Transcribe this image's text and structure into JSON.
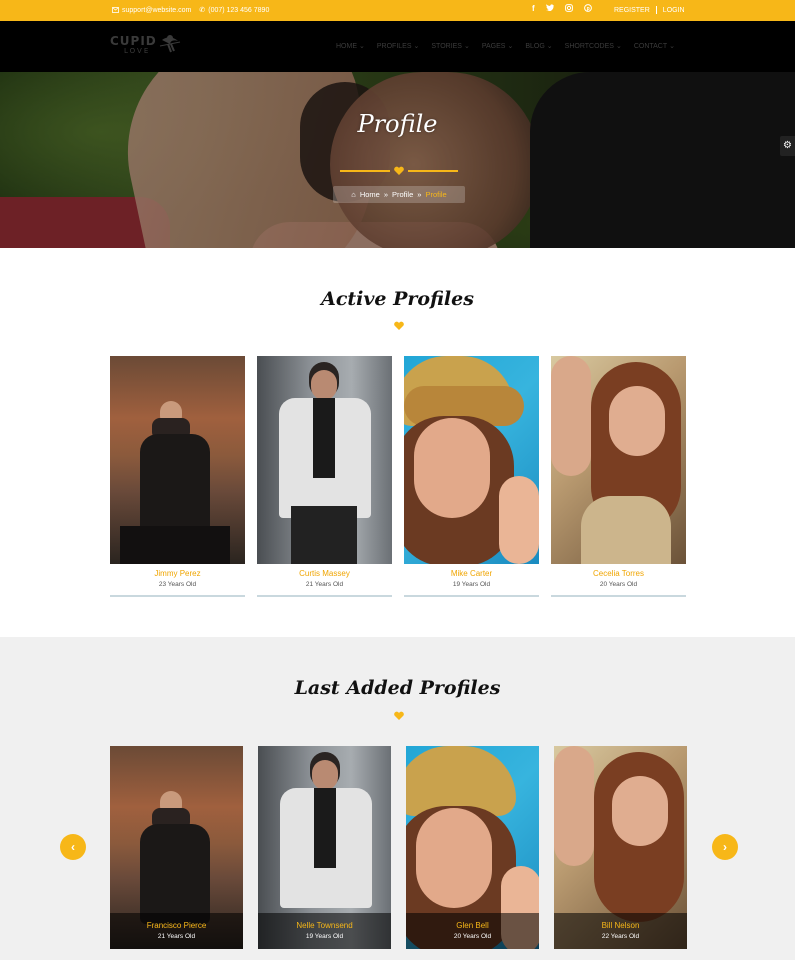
{
  "topbar": {
    "email": "support@website.com",
    "phone": "(007) 123 456 7890",
    "social": [
      "f",
      "t",
      "ig",
      "p"
    ],
    "register": "REGISTER",
    "login": "LOGIN"
  },
  "brand": {
    "name": "CUPID",
    "sub": "LOVE"
  },
  "nav": {
    "items": [
      "HOME",
      "PROFILES",
      "STORIES",
      "PAGES",
      "BLOG",
      "SHORTCODES",
      "CONTACT"
    ]
  },
  "hero": {
    "title": "Profile",
    "breadcrumb": [
      "Home",
      "Profile",
      "Profile"
    ]
  },
  "active": {
    "title": "Active Profiles",
    "profiles": [
      {
        "name": "Jimmy Perez",
        "age": "23 Years Old"
      },
      {
        "name": "Curtis Massey",
        "age": "21 Years Old"
      },
      {
        "name": "Mike Carter",
        "age": "19 Years Old"
      },
      {
        "name": "Cecelia Torres",
        "age": "20 Years Old"
      }
    ]
  },
  "last": {
    "title": "Last Added Profiles",
    "profiles": [
      {
        "name": "Francisco Pierce",
        "age": "21 Years Old"
      },
      {
        "name": "Nelle Townsend",
        "age": "19 Years Old"
      },
      {
        "name": "Glen Bell",
        "age": "20 Years Old"
      },
      {
        "name": "Bill Nelson",
        "age": "22 Years Old"
      }
    ],
    "prev": "‹",
    "next": "›"
  },
  "colors": {
    "accent": "#f7b718",
    "dark": "#000000",
    "section_bg": "#f0f0f0"
  }
}
